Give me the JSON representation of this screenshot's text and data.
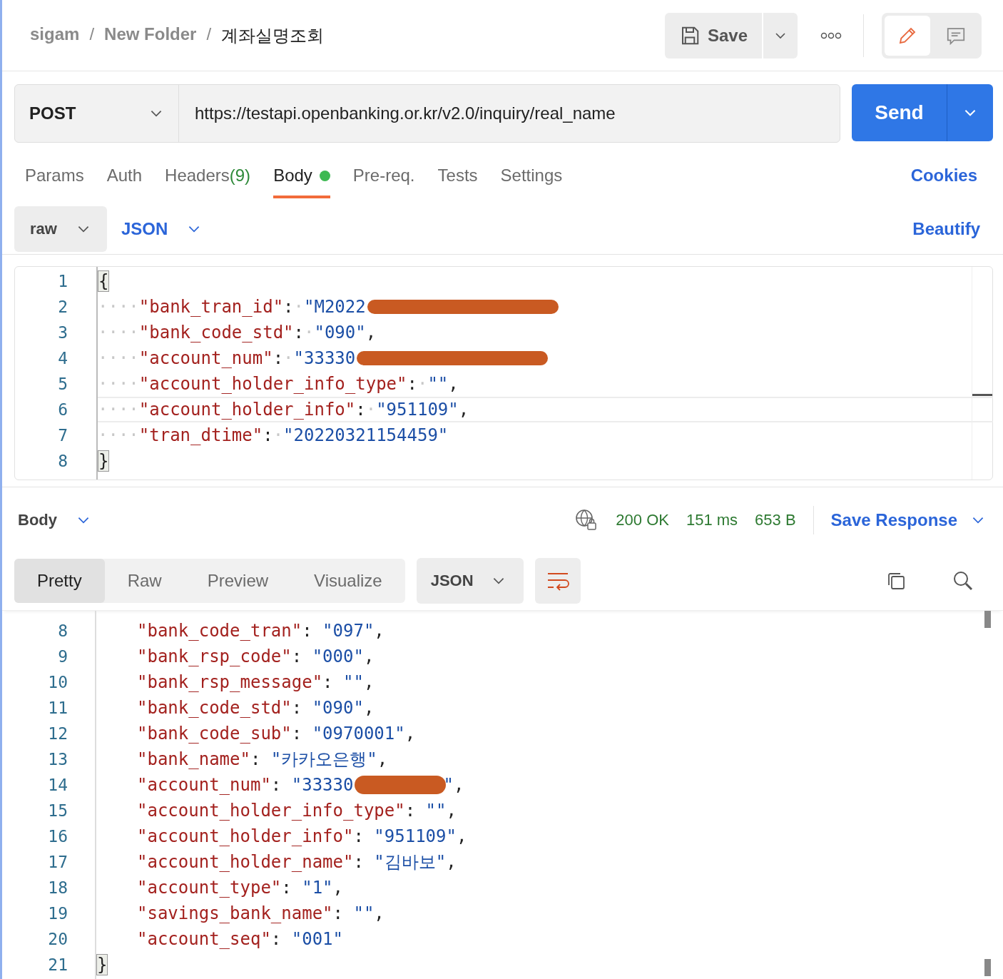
{
  "breadcrumb": [
    {
      "text": "sigam",
      "current": false
    },
    {
      "text": "New Folder",
      "current": false
    },
    {
      "text": "계좌실명조회",
      "current": true
    }
  ],
  "separator": "/",
  "save_button": "Save",
  "request": {
    "method": "POST",
    "url": "https://testapi.openbanking.or.kr/v2.0/inquiry/real_name",
    "send": "Send"
  },
  "tabs": [
    {
      "label": "Params",
      "selected": false
    },
    {
      "label": "Auth",
      "selected": false
    },
    {
      "label": "Headers",
      "count": "(9)",
      "selected": false
    },
    {
      "label": "Body",
      "dot": true,
      "selected": true
    },
    {
      "label": "Pre-req.",
      "selected": false
    },
    {
      "label": "Tests",
      "selected": false
    },
    {
      "label": "Settings",
      "selected": false
    }
  ],
  "cookies": "Cookies",
  "body_mode": "raw",
  "body_language": "JSON",
  "beautify": "Beautify",
  "modes": [
    {
      "kind": "edit",
      "selected": true
    },
    {
      "kind": "comment",
      "selected": false
    }
  ],
  "request_body": {
    "lines": [
      {
        "num": "1",
        "parts": [
          {
            "kind": "brace",
            "text": "{"
          }
        ]
      },
      {
        "num": "2",
        "parts": [
          {
            "kind": "ws",
            "text": "····"
          },
          {
            "kind": "key",
            "text": "\"bank_tran_id\""
          },
          {
            "kind": "punct",
            "text": ":"
          },
          {
            "kind": "ws",
            "text": "·"
          },
          {
            "kind": "string",
            "text": "\"M2022"
          },
          {
            "kind": "redaction"
          }
        ]
      },
      {
        "num": "3",
        "parts": [
          {
            "kind": "ws",
            "text": "····"
          },
          {
            "kind": "key",
            "text": "\"bank_code_std\""
          },
          {
            "kind": "punct",
            "text": ":"
          },
          {
            "kind": "ws",
            "text": "·"
          },
          {
            "kind": "string",
            "text": "\"090\""
          },
          {
            "kind": "punct",
            "text": ","
          }
        ]
      },
      {
        "num": "4",
        "parts": [
          {
            "kind": "ws",
            "text": "····"
          },
          {
            "kind": "key",
            "text": "\"account_num\""
          },
          {
            "kind": "punct",
            "text": ":"
          },
          {
            "kind": "ws",
            "text": "·"
          },
          {
            "kind": "string",
            "text": "\"33330"
          },
          {
            "kind": "redaction"
          }
        ]
      },
      {
        "num": "5",
        "parts": [
          {
            "kind": "ws",
            "text": "····"
          },
          {
            "kind": "key",
            "text": "\"account_holder_info_type\""
          },
          {
            "kind": "punct",
            "text": ":"
          },
          {
            "kind": "ws",
            "text": "·"
          },
          {
            "kind": "string",
            "text": "\"\""
          },
          {
            "kind": "punct",
            "text": ","
          }
        ]
      },
      {
        "num": "6",
        "active": true,
        "parts": [
          {
            "kind": "ws",
            "text": "····"
          },
          {
            "kind": "key",
            "text": "\"account_holder_info\""
          },
          {
            "kind": "punct",
            "text": ":"
          },
          {
            "kind": "ws",
            "text": "·"
          },
          {
            "kind": "string",
            "text": "\"951109\""
          },
          {
            "kind": "punct",
            "text": ","
          }
        ]
      },
      {
        "num": "7",
        "parts": [
          {
            "kind": "ws",
            "text": "····"
          },
          {
            "kind": "key",
            "text": "\"tran_dtime\""
          },
          {
            "kind": "punct",
            "text": ":"
          },
          {
            "kind": "ws",
            "text": "·"
          },
          {
            "kind": "string",
            "text": "\"20220321154459\""
          }
        ]
      },
      {
        "num": "8",
        "parts": [
          {
            "kind": "brace",
            "text": "}"
          }
        ]
      }
    ]
  },
  "response": {
    "label": "Body",
    "status": "200 OK",
    "time": "151 ms",
    "size": "653 B",
    "save_response": "Save Response",
    "views": [
      {
        "label": "Pretty",
        "selected": true
      },
      {
        "label": "Raw",
        "selected": false
      },
      {
        "label": "Preview",
        "selected": false
      },
      {
        "label": "Visualize",
        "selected": false
      }
    ],
    "language": "JSON",
    "lines": [
      {
        "num": "8",
        "parts": [
          {
            "kind": "key",
            "text": "\"bank_code_tran\""
          },
          {
            "kind": "punct",
            "text": ": "
          },
          {
            "kind": "string",
            "text": "\"097\""
          },
          {
            "kind": "punct",
            "text": ","
          }
        ]
      },
      {
        "num": "9",
        "parts": [
          {
            "kind": "key",
            "text": "\"bank_rsp_code\""
          },
          {
            "kind": "punct",
            "text": ": "
          },
          {
            "kind": "string",
            "text": "\"000\""
          },
          {
            "kind": "punct",
            "text": ","
          }
        ]
      },
      {
        "num": "10",
        "parts": [
          {
            "kind": "key",
            "text": "\"bank_rsp_message\""
          },
          {
            "kind": "punct",
            "text": ": "
          },
          {
            "kind": "string",
            "text": "\"\""
          },
          {
            "kind": "punct",
            "text": ","
          }
        ]
      },
      {
        "num": "11",
        "parts": [
          {
            "kind": "key",
            "text": "\"bank_code_std\""
          },
          {
            "kind": "punct",
            "text": ": "
          },
          {
            "kind": "string",
            "text": "\"090\""
          },
          {
            "kind": "punct",
            "text": ","
          }
        ]
      },
      {
        "num": "12",
        "parts": [
          {
            "kind": "key",
            "text": "\"bank_code_sub\""
          },
          {
            "kind": "punct",
            "text": ": "
          },
          {
            "kind": "string",
            "text": "\"0970001\""
          },
          {
            "kind": "punct",
            "text": ","
          }
        ]
      },
      {
        "num": "13",
        "parts": [
          {
            "kind": "key",
            "text": "\"bank_name\""
          },
          {
            "kind": "punct",
            "text": ": "
          },
          {
            "kind": "string",
            "text": "\"카카오은행\""
          },
          {
            "kind": "punct",
            "text": ","
          }
        ]
      },
      {
        "num": "14",
        "parts": [
          {
            "kind": "key",
            "text": "\"account_num\""
          },
          {
            "kind": "punct",
            "text": ": "
          },
          {
            "kind": "string",
            "text": "\"33330"
          },
          {
            "kind": "redaction"
          },
          {
            "kind": "string",
            "text": "\""
          },
          {
            "kind": "punct",
            "text": ","
          }
        ]
      },
      {
        "num": "15",
        "parts": [
          {
            "kind": "key",
            "text": "\"account_holder_info_type\""
          },
          {
            "kind": "punct",
            "text": ": "
          },
          {
            "kind": "string",
            "text": "\"\""
          },
          {
            "kind": "punct",
            "text": ","
          }
        ]
      },
      {
        "num": "16",
        "parts": [
          {
            "kind": "key",
            "text": "\"account_holder_info\""
          },
          {
            "kind": "punct",
            "text": ": "
          },
          {
            "kind": "string",
            "text": "\"951109\""
          },
          {
            "kind": "punct",
            "text": ","
          }
        ]
      },
      {
        "num": "17",
        "parts": [
          {
            "kind": "key",
            "text": "\"account_holder_name\""
          },
          {
            "kind": "punct",
            "text": ": "
          },
          {
            "kind": "string",
            "text": "\"김바보\""
          },
          {
            "kind": "punct",
            "text": ","
          }
        ]
      },
      {
        "num": "18",
        "parts": [
          {
            "kind": "key",
            "text": "\"account_type\""
          },
          {
            "kind": "punct",
            "text": ": "
          },
          {
            "kind": "string",
            "text": "\"1\""
          },
          {
            "kind": "punct",
            "text": ","
          }
        ]
      },
      {
        "num": "19",
        "parts": [
          {
            "kind": "key",
            "text": "\"savings_bank_name\""
          },
          {
            "kind": "punct",
            "text": ": "
          },
          {
            "kind": "string",
            "text": "\"\""
          },
          {
            "kind": "punct",
            "text": ","
          }
        ]
      },
      {
        "num": "20",
        "parts": [
          {
            "kind": "key",
            "text": "\"account_seq\""
          },
          {
            "kind": "punct",
            "text": ": "
          },
          {
            "kind": "string",
            "text": "\"001\""
          }
        ]
      },
      {
        "num": "21",
        "parts": [
          {
            "kind": "brace",
            "text": "}"
          }
        ],
        "outdent": true
      }
    ]
  }
}
